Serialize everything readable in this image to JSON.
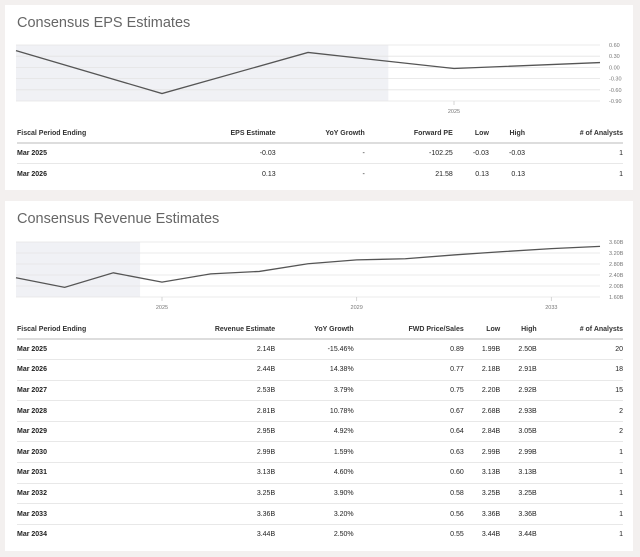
{
  "chart_data": [
    {
      "type": "line",
      "title": "Consensus EPS Estimates",
      "x": [
        "",
        "",
        "",
        "2025",
        ""
      ],
      "values": [
        0.45,
        -0.7,
        0.4,
        -0.03,
        0.13
      ],
      "ylim": [
        -0.9,
        0.6
      ],
      "yticks": [
        "0.60",
        "0.30",
        "0.00",
        "-0.30",
        "-0.60",
        "-0.90"
      ],
      "xtick_labels": [
        {
          "index": 3,
          "label": "2025"
        }
      ],
      "shaded_until_index": 2.55
    },
    {
      "type": "line",
      "title": "Consensus Revenue Estimates",
      "x": [
        "",
        "",
        "",
        "2025",
        "",
        "",
        "",
        "2029",
        "",
        "",
        "",
        "2033",
        ""
      ],
      "values": [
        2.3,
        1.95,
        2.48,
        2.14,
        2.44,
        2.53,
        2.81,
        2.95,
        2.99,
        3.13,
        3.25,
        3.36,
        3.44
      ],
      "ylim": [
        1.6,
        3.6
      ],
      "yticks": [
        "3.60B",
        "3.20B",
        "2.80B",
        "2.40B",
        "2.00B",
        "1.60B"
      ],
      "xtick_labels": [
        {
          "index": 3,
          "label": "2025"
        },
        {
          "index": 7,
          "label": "2029"
        },
        {
          "index": 11,
          "label": "2033"
        }
      ],
      "shaded_until_index": 2.55
    }
  ],
  "eps": {
    "title": "Consensus EPS Estimates",
    "headers": [
      "Fiscal Period Ending",
      "EPS Estimate",
      "YoY Growth",
      "Forward PE",
      "Low",
      "High",
      "# of Analysts"
    ],
    "rows": [
      [
        "Mar 2025",
        "-0.03",
        "-",
        "-102.25",
        "-0.03",
        "-0.03",
        "1"
      ],
      [
        "Mar 2026",
        "0.13",
        "-",
        "21.58",
        "0.13",
        "0.13",
        "1"
      ]
    ]
  },
  "rev": {
    "title": "Consensus Revenue Estimates",
    "headers": [
      "Fiscal Period Ending",
      "Revenue Estimate",
      "YoY Growth",
      "FWD Price/Sales",
      "Low",
      "High",
      "# of Analysts"
    ],
    "rows": [
      [
        "Mar 2025",
        "2.14B",
        "-15.46%",
        "0.89",
        "1.99B",
        "2.50B",
        "20"
      ],
      [
        "Mar 2026",
        "2.44B",
        "14.38%",
        "0.77",
        "2.18B",
        "2.91B",
        "18"
      ],
      [
        "Mar 2027",
        "2.53B",
        "3.79%",
        "0.75",
        "2.20B",
        "2.92B",
        "15"
      ],
      [
        "Mar 2028",
        "2.81B",
        "10.78%",
        "0.67",
        "2.68B",
        "2.93B",
        "2"
      ],
      [
        "Mar 2029",
        "2.95B",
        "4.92%",
        "0.64",
        "2.84B",
        "3.05B",
        "2"
      ],
      [
        "Mar 2030",
        "2.99B",
        "1.59%",
        "0.63",
        "2.99B",
        "2.99B",
        "1"
      ],
      [
        "Mar 2031",
        "3.13B",
        "4.60%",
        "0.60",
        "3.13B",
        "3.13B",
        "1"
      ],
      [
        "Mar 2032",
        "3.25B",
        "3.90%",
        "0.58",
        "3.25B",
        "3.25B",
        "1"
      ],
      [
        "Mar 2033",
        "3.36B",
        "3.20%",
        "0.56",
        "3.36B",
        "3.36B",
        "1"
      ],
      [
        "Mar 2034",
        "3.44B",
        "2.50%",
        "0.55",
        "3.44B",
        "3.44B",
        "1"
      ]
    ]
  }
}
